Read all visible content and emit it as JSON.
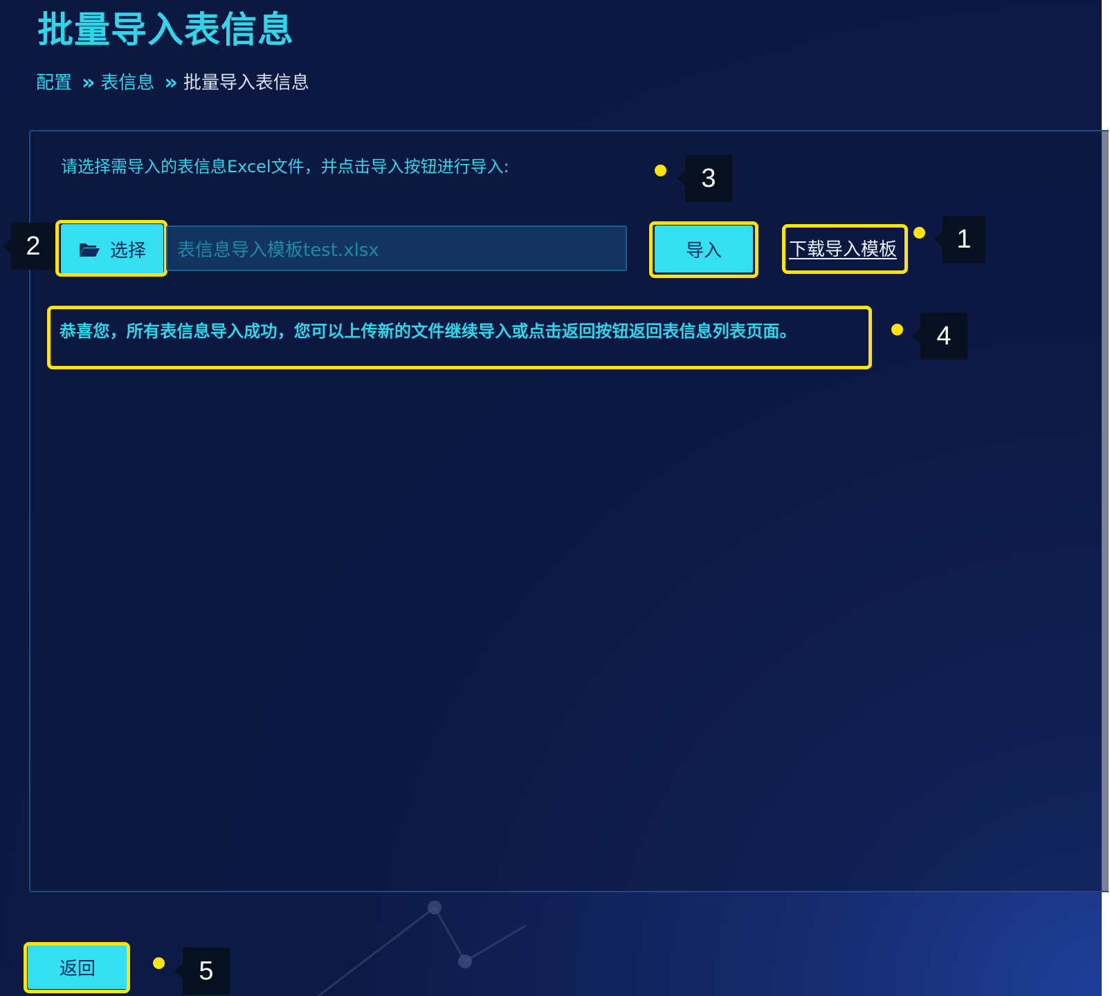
{
  "page": {
    "title": "批量导入表信息"
  },
  "breadcrumb": {
    "items": [
      "配置",
      "表信息",
      "批量导入表信息"
    ],
    "separator": "»"
  },
  "import_form": {
    "instruction": "请选择需导入的表信息Excel文件，并点击导入按钮进行导入:",
    "choose_button_label": "选择",
    "choose_button_icon": "folder-open-icon",
    "file_input_value": "表信息导入模板test.xlsx",
    "import_button_label": "导入",
    "download_template_link": "下载导入模板",
    "success_message": "恭喜您，所有表信息导入成功，您可以上传新的文件继续导入或点击返回按钮返回表信息列表页面。"
  },
  "footer": {
    "back_button_label": "返回"
  },
  "callouts": [
    "1",
    "2",
    "3",
    "4",
    "5"
  ],
  "colors": {
    "accent": "#2fd6ea",
    "button_bg": "#33dff0",
    "highlight": "#ffe500",
    "background": "#0b173f"
  }
}
